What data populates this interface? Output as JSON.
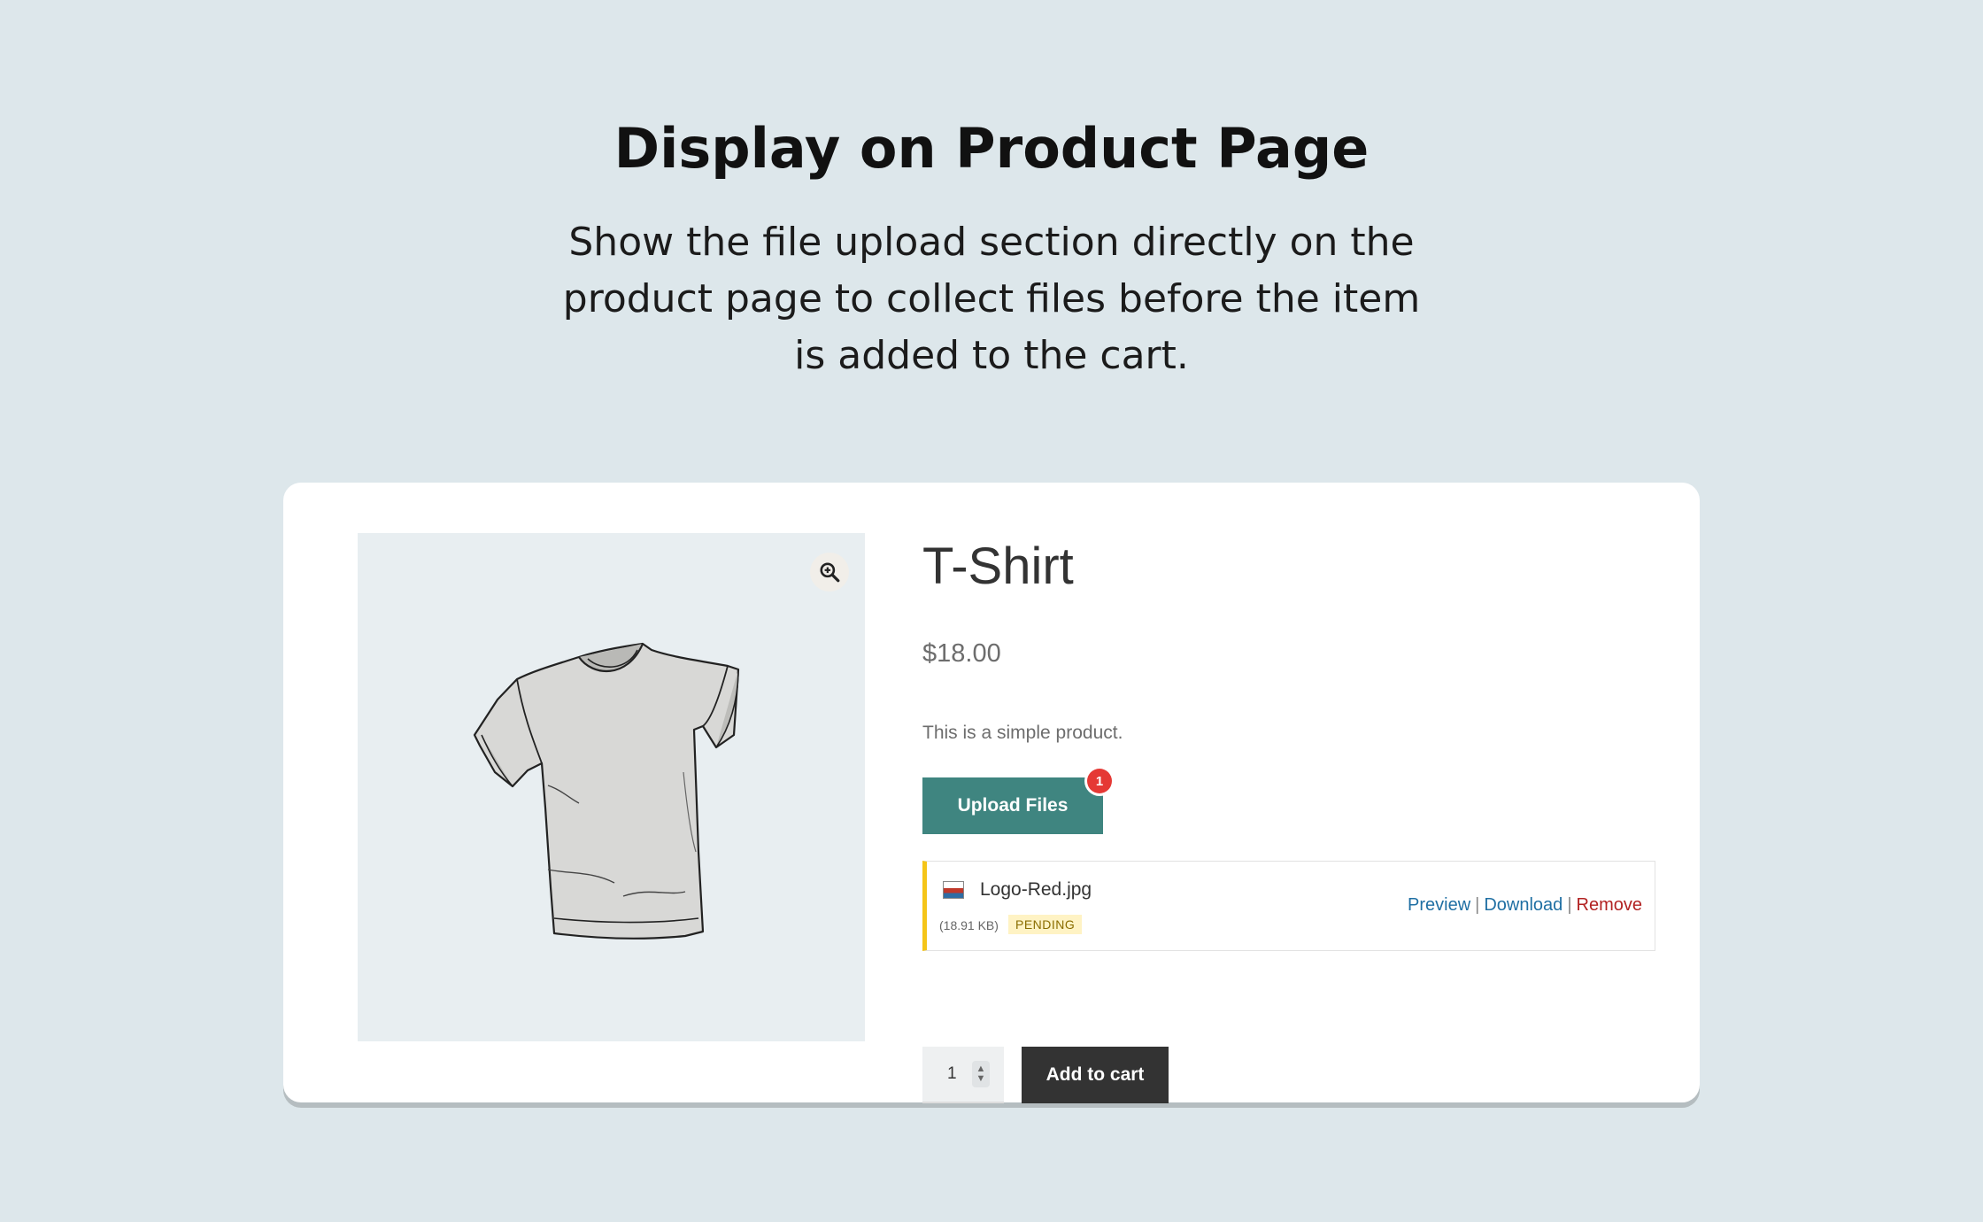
{
  "hero": {
    "title": "Display on Product Page",
    "subtitle": "Show the file upload section directly on the product page to collect files before the item is added to the cart."
  },
  "product": {
    "title": "T-Shirt",
    "price": "$18.00",
    "description": "This is a simple product.",
    "image_icon": "tshirt-illustration",
    "zoom_icon": "magnifier-plus-icon"
  },
  "upload": {
    "button_label": "Upload Files",
    "badge_count": "1"
  },
  "file": {
    "name": "Logo-Red.jpg",
    "size": "(18.91 KB)",
    "status": "PENDING",
    "actions": {
      "preview": "Preview",
      "download": "Download",
      "remove": "Remove",
      "separator": "|"
    },
    "status_color": "#f5c518"
  },
  "cart": {
    "quantity": "1",
    "add_label": "Add to cart"
  },
  "colors": {
    "upload_button": "#3f8580",
    "add_button": "#333333",
    "badge": "#e53935",
    "link": "#1f6fa3",
    "remove": "#b22222"
  }
}
